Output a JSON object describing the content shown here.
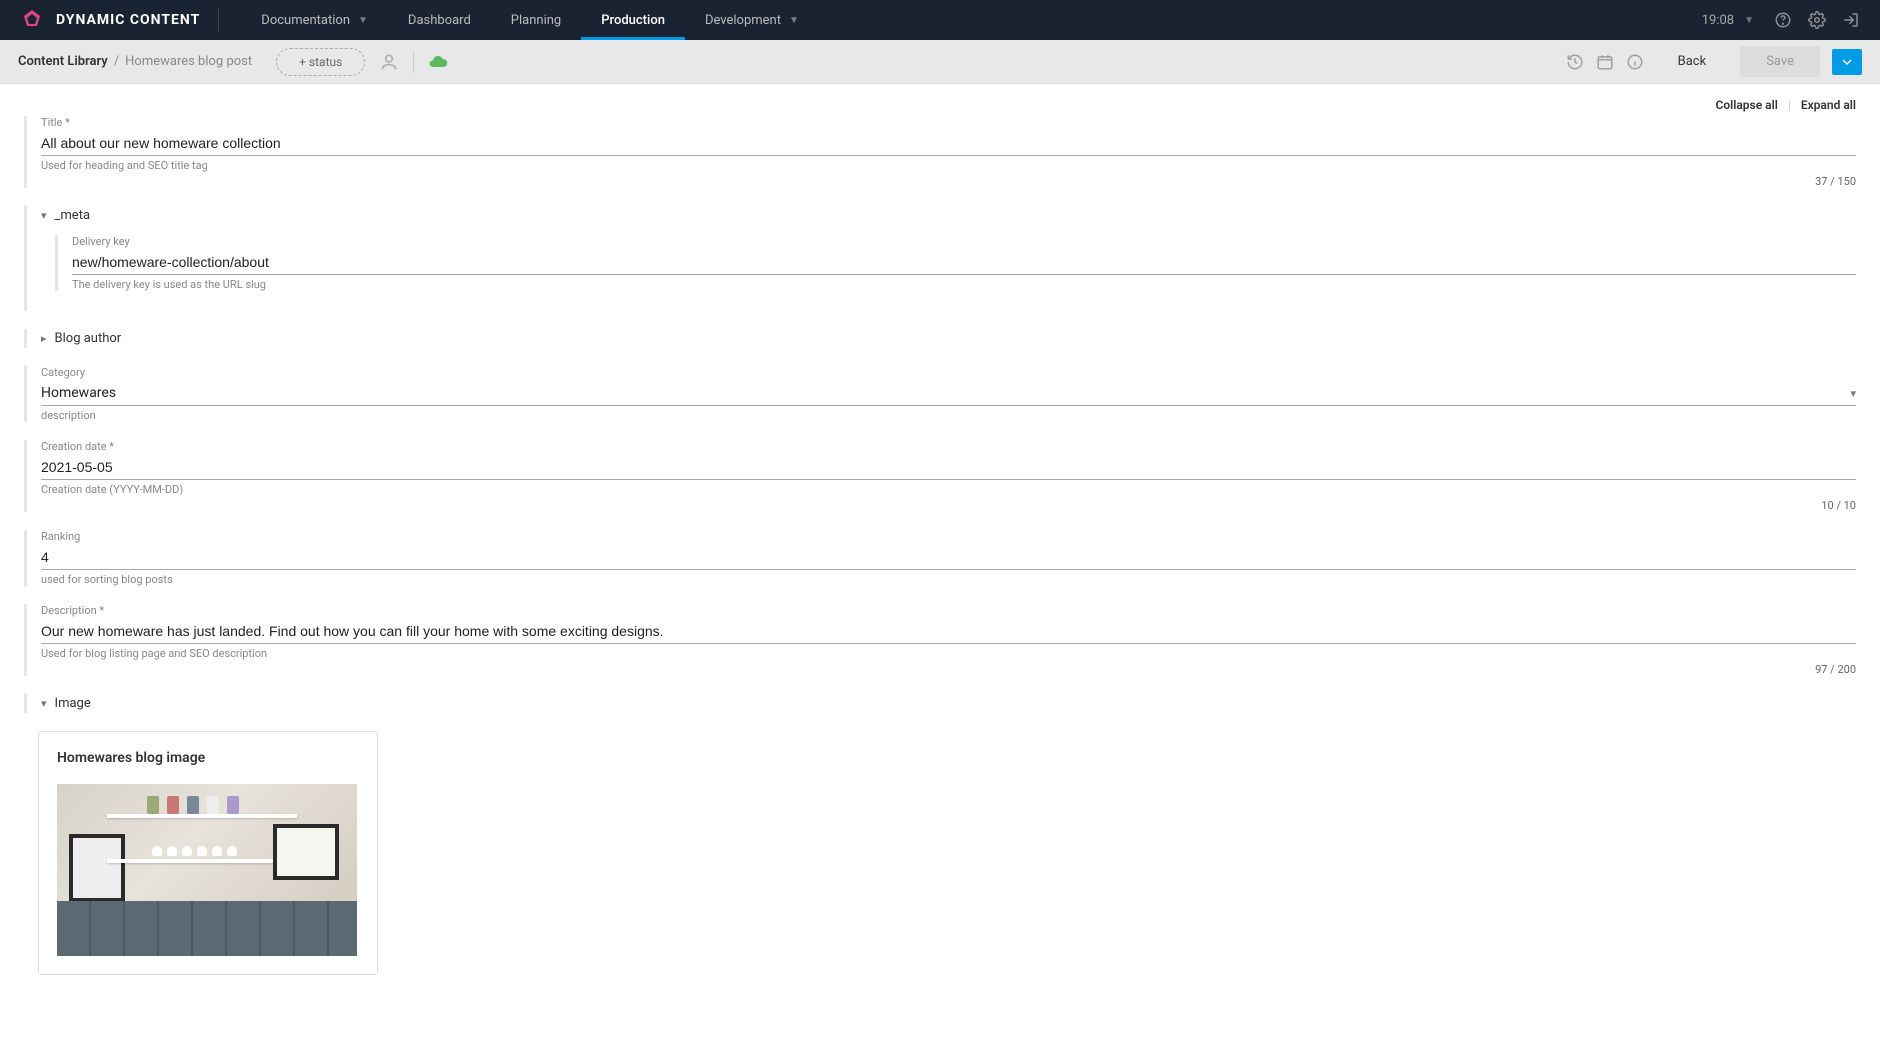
{
  "brand": "DYNAMIC CONTENT",
  "nav": {
    "documentation": "Documentation",
    "dashboard": "Dashboard",
    "planning": "Planning",
    "production": "Production",
    "development": "Development"
  },
  "time": "19:08",
  "breadcrumb": {
    "root": "Content Library",
    "leaf": "Homewares blog post"
  },
  "status_chip": "+ status",
  "buttons": {
    "back": "Back",
    "save": "Save",
    "collapse_all": "Collapse all",
    "expand_all": "Expand all"
  },
  "fields": {
    "title": {
      "label": "Title *",
      "value": "All about our new homeware collection",
      "helper": "Used for heading and SEO title tag",
      "counter": "37 / 150"
    },
    "meta_section": "_meta",
    "delivery_key": {
      "label": "Delivery key",
      "value": "new/homeware-collection/about",
      "helper": "The delivery key is used as the URL slug"
    },
    "blog_author_section": "Blog author",
    "category": {
      "label": "Category",
      "value": "Homewares",
      "helper": "description"
    },
    "creation_date": {
      "label": "Creation date *",
      "value": "2021-05-05",
      "helper": "Creation date (YYYY-MM-DD)",
      "counter": "10 / 10"
    },
    "ranking": {
      "label": "Ranking",
      "value": "4",
      "helper": "used for sorting blog posts"
    },
    "description": {
      "label": "Description *",
      "value": "Our new homeware has just landed. Find out how you can fill your home with some exciting designs.",
      "helper": "Used for blog listing page and SEO description",
      "counter": "97 / 200"
    },
    "image_section": "Image",
    "image_card_title": "Homewares blog image"
  }
}
